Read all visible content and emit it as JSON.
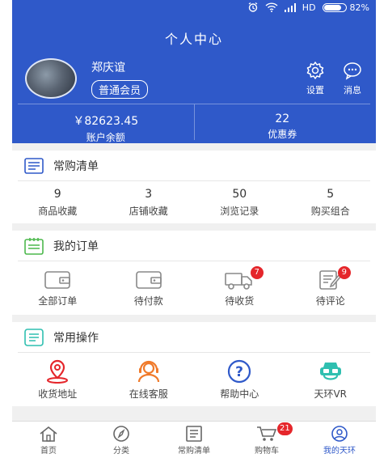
{
  "status_bar": {
    "hd": "HD",
    "battery": "82%",
    "battery_level": 0.82
  },
  "header": {
    "title": "个人中心"
  },
  "profile": {
    "name": "郑庆谊",
    "level": "普通会员"
  },
  "header_actions": [
    {
      "label": "设置",
      "icon": "gear-icon"
    },
    {
      "label": "消息",
      "icon": "message-icon"
    }
  ],
  "stats": [
    {
      "value": "￥82623.45",
      "label": "账户余额"
    },
    {
      "value": "22",
      "label": "优惠券"
    }
  ],
  "frequent": {
    "title": "常购清单",
    "items": [
      {
        "count": "9",
        "label": "商品收藏"
      },
      {
        "count": "3",
        "label": "店铺收藏"
      },
      {
        "count": "50",
        "label": "浏览记录"
      },
      {
        "count": "5",
        "label": "购买组合"
      }
    ]
  },
  "orders": {
    "title": "我的订单",
    "items": [
      {
        "label": "全部订单",
        "icon": "wallet-icon",
        "badge": ""
      },
      {
        "label": "待付款",
        "icon": "wallet-icon",
        "badge": ""
      },
      {
        "label": "待收货",
        "icon": "delivery-truck-icon",
        "badge": "7"
      },
      {
        "label": "待评论",
        "icon": "edit-note-icon",
        "badge": "9"
      }
    ]
  },
  "operations": {
    "title": "常用操作",
    "items": [
      {
        "label": "收货地址",
        "icon": "location-pin-icon"
      },
      {
        "label": "在线客服",
        "icon": "headset-icon"
      },
      {
        "label": "帮助中心",
        "icon": "help-icon"
      },
      {
        "label": "天环VR",
        "icon": "vr-headset-icon"
      }
    ]
  },
  "tabbar": {
    "items": [
      {
        "label": "首页",
        "icon": "home-icon",
        "badge": ""
      },
      {
        "label": "分类",
        "icon": "compass-icon",
        "badge": ""
      },
      {
        "label": "常购清单",
        "icon": "list-icon",
        "badge": ""
      },
      {
        "label": "购物车",
        "icon": "cart-icon",
        "badge": "21"
      },
      {
        "label": "我的天环",
        "icon": "user-icon",
        "badge": "",
        "active": true
      }
    ]
  },
  "colors": {
    "brand": "#2f59c9",
    "badge": "#e5262b",
    "location": "#e5262b",
    "headset": "#f07a2a",
    "vr": "#2fbfb0"
  }
}
